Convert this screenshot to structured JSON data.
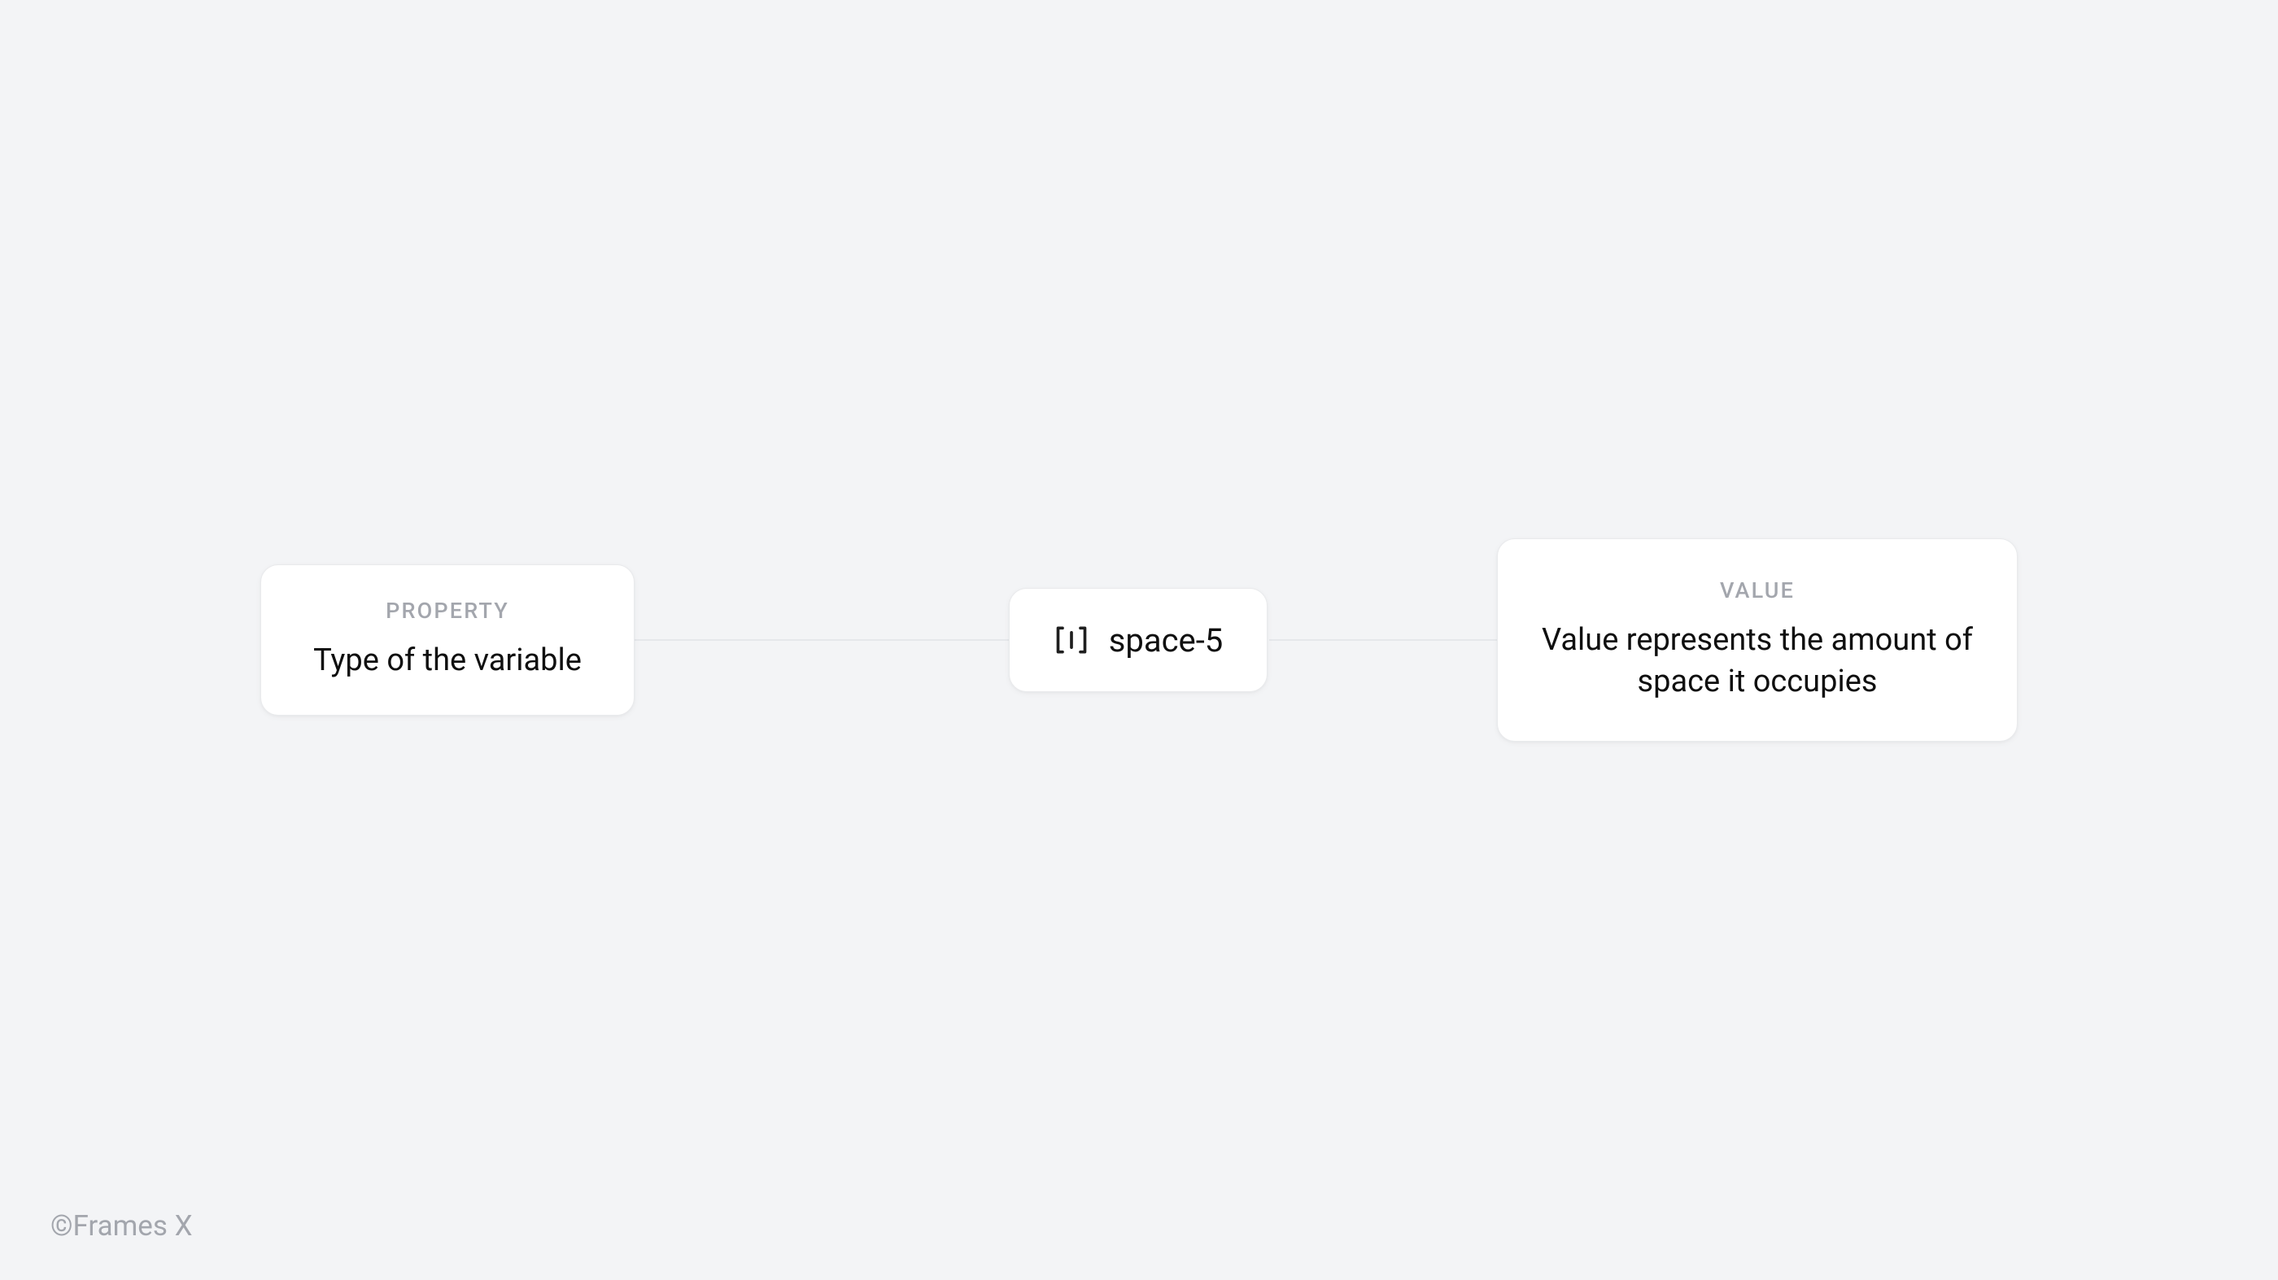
{
  "property_card": {
    "label": "PROPERTY",
    "text": "Type of the variable"
  },
  "token_card": {
    "icon_name": "spacing-icon",
    "text": "space-5"
  },
  "value_card": {
    "label": "VALUE",
    "text": "Value represents the amount of space it occupies"
  },
  "watermark": "©Frames X"
}
